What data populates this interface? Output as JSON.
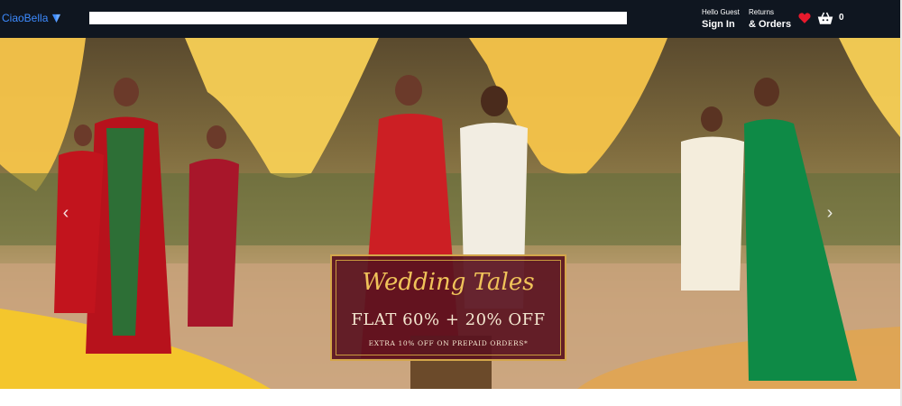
{
  "header": {
    "logo_text": "CiaoBella",
    "search_placeholder": "",
    "account_greeting": "Hello Guest",
    "account_action": "Sign In",
    "returns_line1": "Returns",
    "returns_line2": "& Orders",
    "cart_count": "0",
    "icons": {
      "logo": "heart-shield-icon",
      "wishlist": "heart-icon",
      "cart": "basket-icon"
    },
    "colors": {
      "background": "#0f1620",
      "logo": "#3d8bff",
      "heart": "#e8192c"
    }
  },
  "hero": {
    "promo_title": "Wedding Tales",
    "promo_offer": "FLAT 60% + 20% OFF",
    "promo_note": "EXTRA 10% OFF ON PREPAID ORDERS*",
    "prev_icon": "chevron-left-icon",
    "next_icon": "chevron-right-icon"
  }
}
